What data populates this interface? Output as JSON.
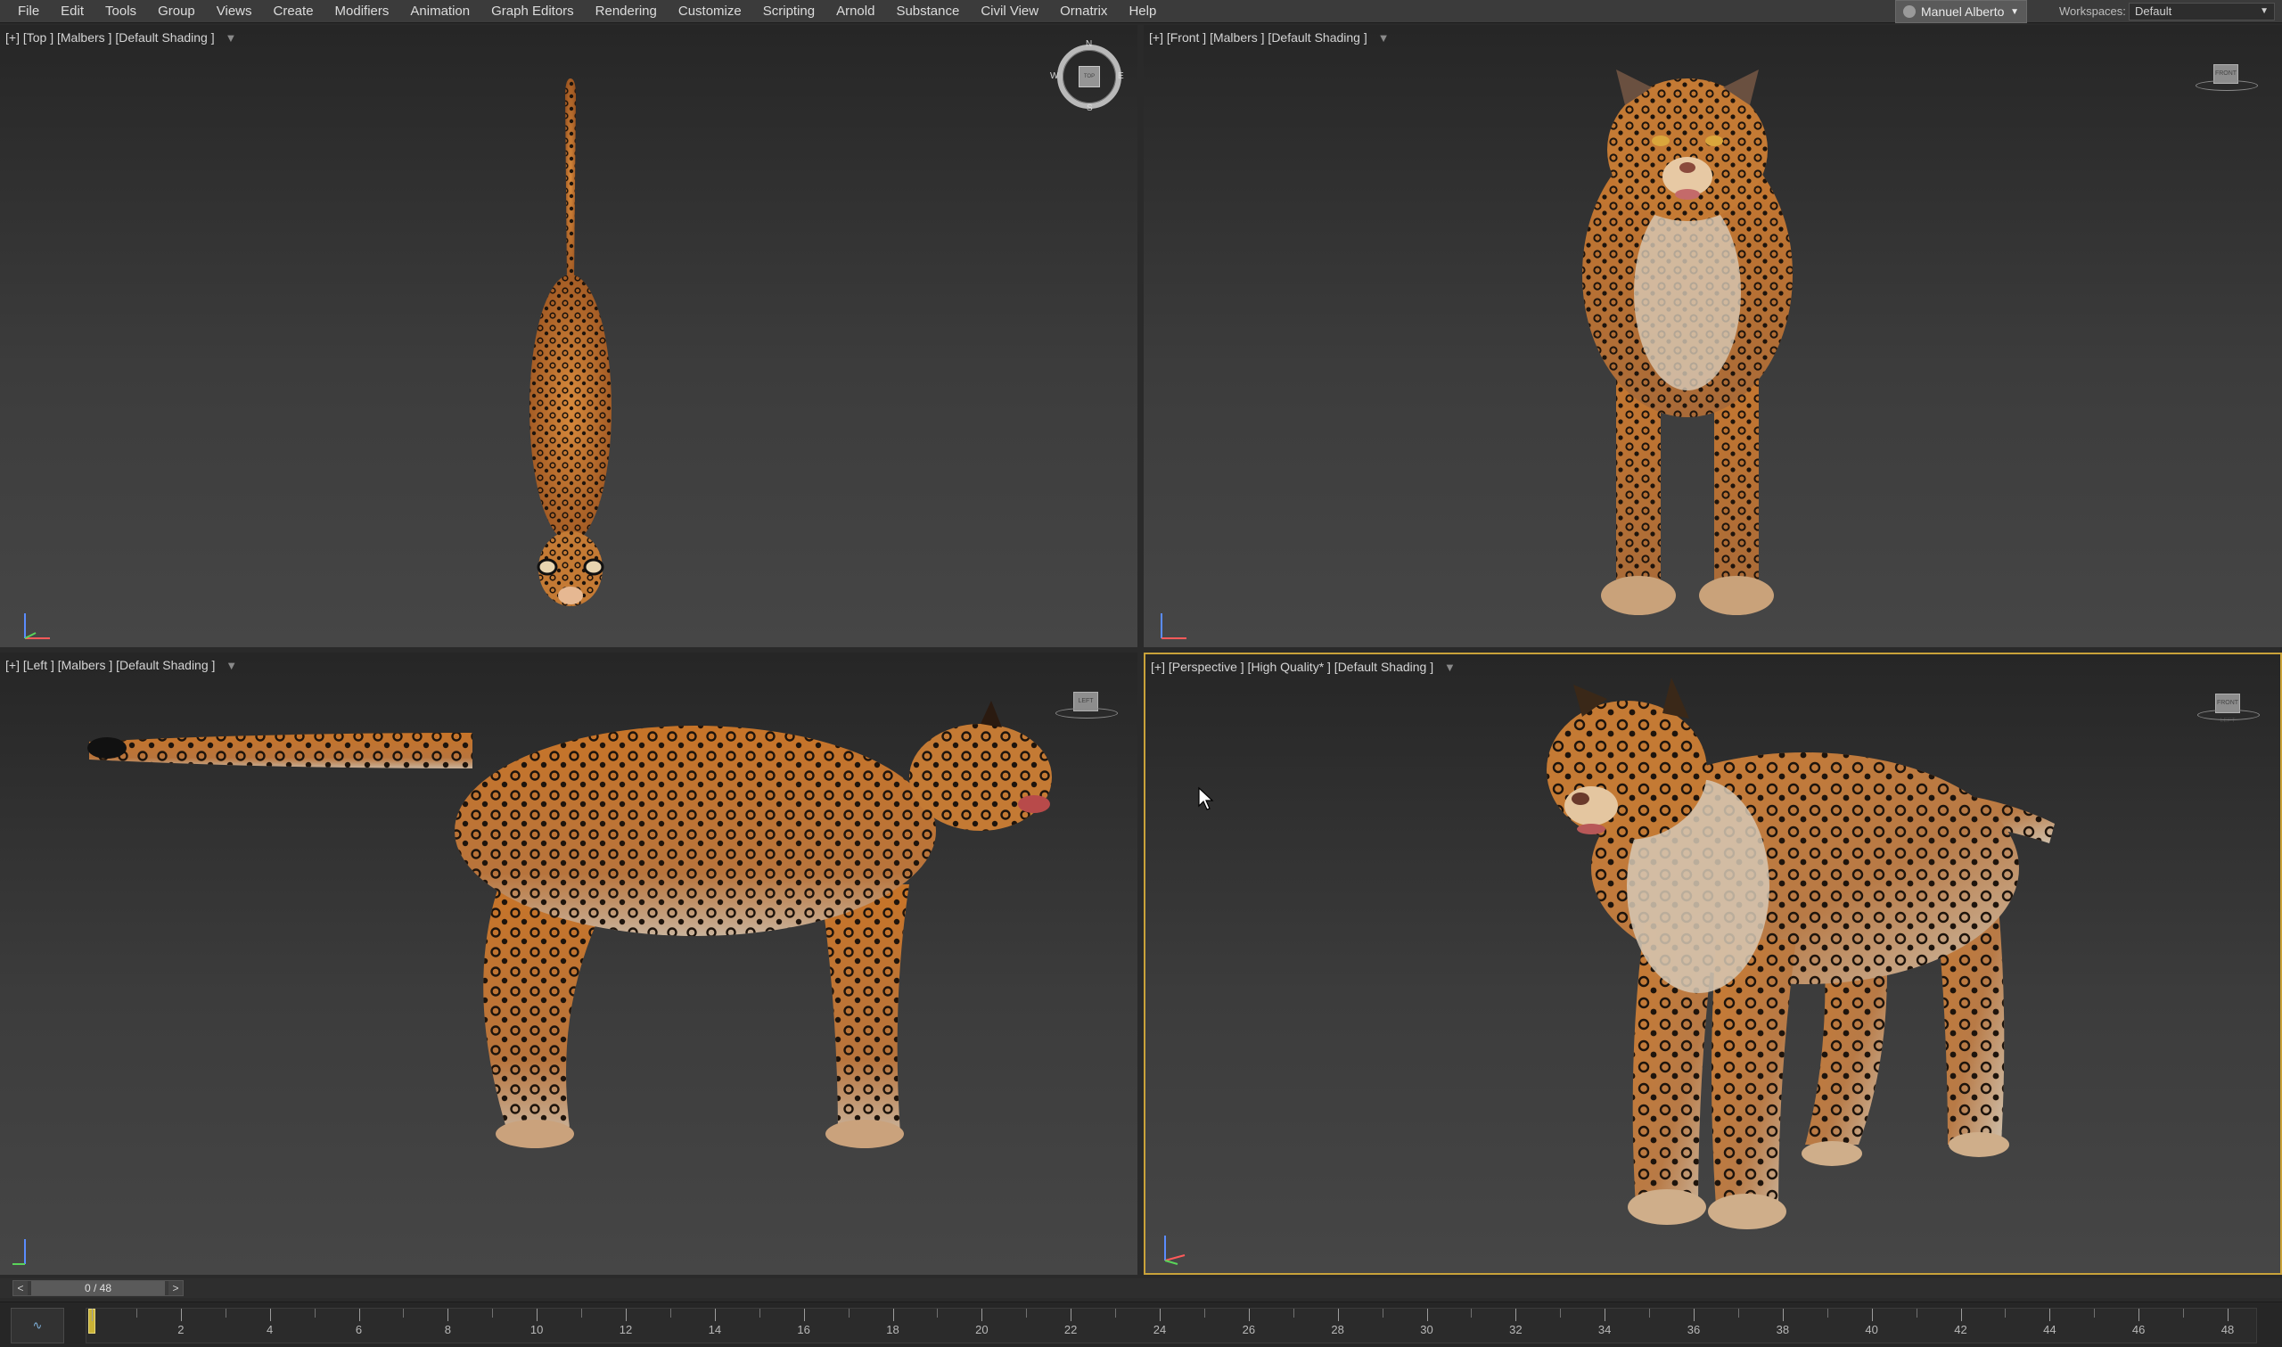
{
  "menubar": {
    "items": [
      "File",
      "Edit",
      "Tools",
      "Group",
      "Views",
      "Create",
      "Modifiers",
      "Animation",
      "Graph Editors",
      "Rendering",
      "Customize",
      "Scripting",
      "Arnold",
      "Substance",
      "Civil View",
      "Ornatrix",
      "Help"
    ],
    "user": "Manuel Alberto",
    "workspaces_label": "Workspaces:",
    "workspaces_value": "Default"
  },
  "viewports": {
    "top": {
      "label": "[+] [Top ] [Malbers ] [Default Shading ]",
      "compass": {
        "n": "N",
        "s": "S",
        "e": "E",
        "w": "W",
        "cube": "TOP"
      }
    },
    "front": {
      "label": "[+] [Front ] [Malbers ] [Default Shading ]",
      "cube": "FRONT"
    },
    "left": {
      "label": "[+] [Left ] [Malbers ] [Default Shading ]",
      "cube": "LEFT"
    },
    "perspective": {
      "label": "[+] [Perspective ] [High Quality* ] [Default Shading ]",
      "cube": "FRONT LEFT"
    }
  },
  "timeline": {
    "frame_display": "0 / 48",
    "prev": "<",
    "next": ">",
    "current_frame": 0,
    "total_frames": 48,
    "ticks": [
      "2",
      "4",
      "6",
      "8",
      "10",
      "12",
      "14",
      "16",
      "18",
      "20",
      "22",
      "24",
      "26",
      "28",
      "30",
      "32",
      "34",
      "36",
      "38",
      "40",
      "42",
      "44",
      "46",
      "48"
    ],
    "curve_editor_icon": "curve-editor-icon"
  },
  "colors": {
    "active_viewport_border": "#c9a23a",
    "leopard_base": "#c8752c",
    "leopard_light": "#e8c9a0",
    "spot": "#1e140c"
  }
}
